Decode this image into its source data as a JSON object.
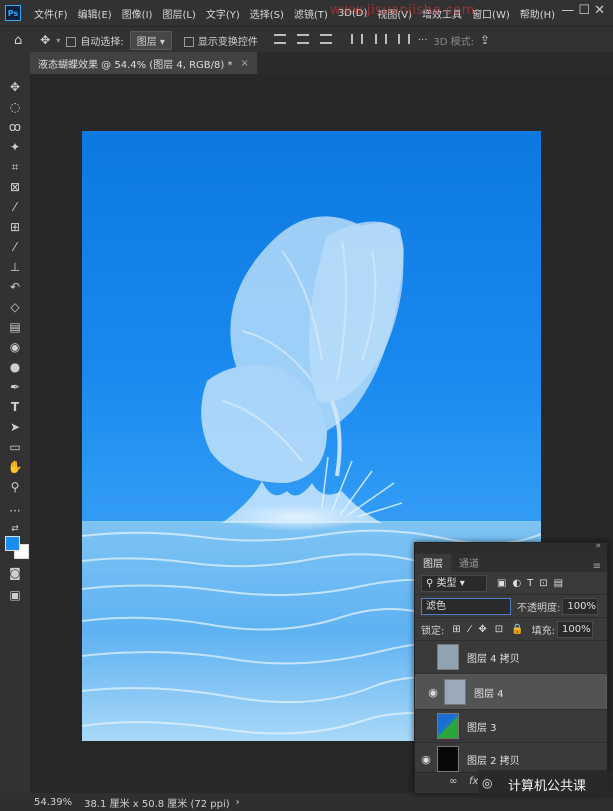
{
  "menubar": {
    "logo": "Ps",
    "items": [
      "文件(F)",
      "编辑(E)",
      "图像(I)",
      "图层(L)",
      "文字(Y)",
      "选择(S)",
      "滤镜(T)",
      "3D(D)",
      "视图(V)",
      "增效工具",
      "窗口(W)",
      "帮助(H)"
    ],
    "watermark": "www.jisuanjishe.com",
    "window_controls": "—  ☐  ✕"
  },
  "options": {
    "auto_select_label": "自动选择:",
    "auto_select_value": "图层",
    "transform_label": "显示变换控件",
    "mode_3d": "3D 模式:"
  },
  "document": {
    "tab_title": "液态蝴蝶效果 @ 54.4% (图层 4, RGB/8) *",
    "tab_close": "×"
  },
  "status": {
    "zoom": "54.39%",
    "size": "38.1 厘米 x 50.8 厘米 (72 ppi)"
  },
  "layers_panel": {
    "tabs": [
      "图层",
      "通道"
    ],
    "filter_kind": "类型",
    "blend_mode": "滤色",
    "opacity_label": "不透明度:",
    "opacity_value": "100%",
    "lock_label": "锁定:",
    "fill_label": "填充:",
    "fill_value": "100%",
    "layers": [
      {
        "name": "图层 4 拷贝",
        "visible": false,
        "selected": false
      },
      {
        "name": "图层 4",
        "visible": true,
        "selected": true
      },
      {
        "name": "图层 3",
        "visible": false,
        "selected": false
      },
      {
        "name": "图层 2 拷贝",
        "visible": true,
        "selected": false
      }
    ],
    "footer_fx": "fx"
  },
  "overlay": {
    "wechat_label": "计算机公共课"
  },
  "colors": {
    "foreground": "#1a8cf2",
    "background": "#ffffff",
    "accent": "#31a8ff"
  }
}
